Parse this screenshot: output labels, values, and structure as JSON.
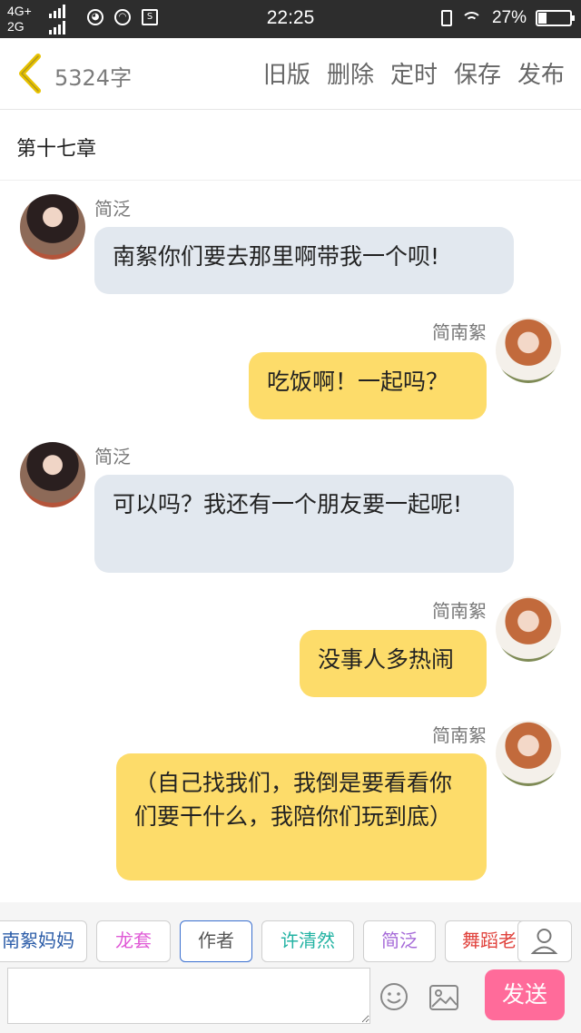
{
  "status_bar": {
    "network_top": "4G+",
    "network_bottom": "2G",
    "time": "22:25",
    "battery": "27%",
    "battery_level": 0.27
  },
  "header": {
    "word_count": "5324字",
    "actions": [
      "旧版",
      "删除",
      "定时",
      "保存",
      "发布"
    ]
  },
  "chapter_title": "第十七章",
  "messages": [
    {
      "side": "left",
      "sender": "简泛",
      "text": "南絮你们要去那里啊带我一个呗!"
    },
    {
      "side": "right",
      "sender": "简南絮",
      "text": "吃饭啊！一起吗？"
    },
    {
      "side": "left",
      "sender": "简泛",
      "text": "可以吗？我还有一个朋友要一起呢!"
    },
    {
      "side": "right",
      "sender": "简南絮",
      "text": "没事人多热闹"
    },
    {
      "side": "right",
      "sender": "简南絮",
      "text": "（自己找我们，我倒是要看看你们要干什么，我陪你们玩到底）"
    }
  ],
  "characters": [
    {
      "name": "南絮妈妈",
      "color": "#2b5ca8"
    },
    {
      "name": "龙套",
      "color": "#e05ad6"
    },
    {
      "name": "作者",
      "color": "#555555"
    },
    {
      "name": "许清然",
      "color": "#23b3a3"
    },
    {
      "name": "简泛",
      "color": "#a56ad8"
    },
    {
      "name": "舞蹈老师",
      "color": "#e0413b"
    }
  ],
  "input": {
    "placeholder": "",
    "send_label": "发送"
  },
  "colors": {
    "left_bubble": "#e2e8ef",
    "right_bubble": "#fddc6a",
    "send_button": "#ff6b9a",
    "back_arrow": "#e8c200"
  }
}
